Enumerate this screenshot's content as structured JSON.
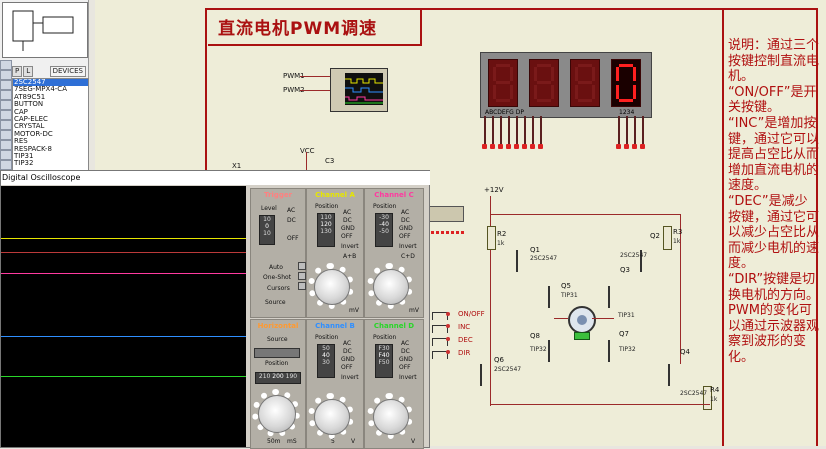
{
  "title": "直流电机PWM调速",
  "note": [
    "说明：通过三个按键控制直流电机。",
    "“ON/OFF”是开关按键。",
    "“INC”是增加按键，通过它可以提高占空比从而增加直流电机的速度。",
    "“DEC”是减少按键，通过它可以减少占空比从而减少电机的速度。",
    "“DIR”按键是切换电机的方向。PWM的变化可以通过示波器观察到波形的变化。"
  ],
  "device_panel": {
    "tab_p": "P",
    "tab_l": "L",
    "devices_label": "DEVICES",
    "items": [
      "2SC2547",
      "7SEG-MPX4-CA",
      "AT89C51",
      "BUTTON",
      "CAP",
      "CAP-ELEC",
      "CRYSTAL",
      "MOTOR-DC",
      "RES",
      "RESPACK-8",
      "TIP31",
      "TIP32"
    ],
    "selected_index": 0
  },
  "display": {
    "value": "0",
    "segment_label": "ABCDEFG DP",
    "digit_label": "1234"
  },
  "scope": {
    "window_title": "Digital Oscilloscope",
    "trigger_title": "Trigger",
    "channel_a_title": "Channel A",
    "channel_b_title": "Channel B",
    "channel_c_title": "Channel C",
    "channel_d_title": "Channel D",
    "horizontal_title": "Horizontal",
    "level_label": "Level",
    "position_label": "Position",
    "source_label": "Source",
    "auto_label": "Auto",
    "one_shot_label": "One-Shot",
    "cursors_label": "Cursors",
    "invert_label": "Invert",
    "a_plus_b_label": "A+B",
    "c_plus_d_label": "C+D",
    "ac": "AC",
    "dc": "DC",
    "gnd": "GND",
    "off": "OFF",
    "trigger_level": [
      "10",
      "0",
      "10"
    ],
    "channel_a_position": [
      "110",
      "120",
      "130"
    ],
    "channel_c_position": [
      "-30",
      "-40",
      "-50"
    ],
    "channel_b_position": [
      "50",
      "40",
      "30"
    ],
    "channel_d_position": [
      "F30",
      "F40",
      "F50"
    ],
    "horizontal_position": [
      "210",
      "200",
      "190"
    ],
    "mv_unit": "mV",
    "v_unit": "V",
    "ms_unit": "mS",
    "time_value": "50m",
    "vol_value": "5",
    "colors": {
      "a": "#e6e600",
      "b": "#2f8fff",
      "c": "#ff3aa0",
      "d": "#29d629",
      "trigger": "#d04040"
    }
  },
  "schematic": {
    "x1": "X1",
    "c3": "C3",
    "vcc": "VCC",
    "vplus": "+12V",
    "pwm1": "PWM1",
    "pwm2": "PWM2",
    "r2": "R2",
    "r3": "R3",
    "r4": "R4",
    "r_val": "1k",
    "tip31": "TIP31",
    "tip32": "TIP32",
    "q1": "Q1",
    "q2": "Q2",
    "q3": "Q3",
    "q4": "Q4",
    "q5": "Q5",
    "q6": "Q6",
    "q7": "Q7",
    "q8": "Q8",
    "q_part": "2SC2547",
    "on_off": "ON/OFF",
    "inc": "INC",
    "dec": "DEC",
    "dir": "DIR"
  }
}
